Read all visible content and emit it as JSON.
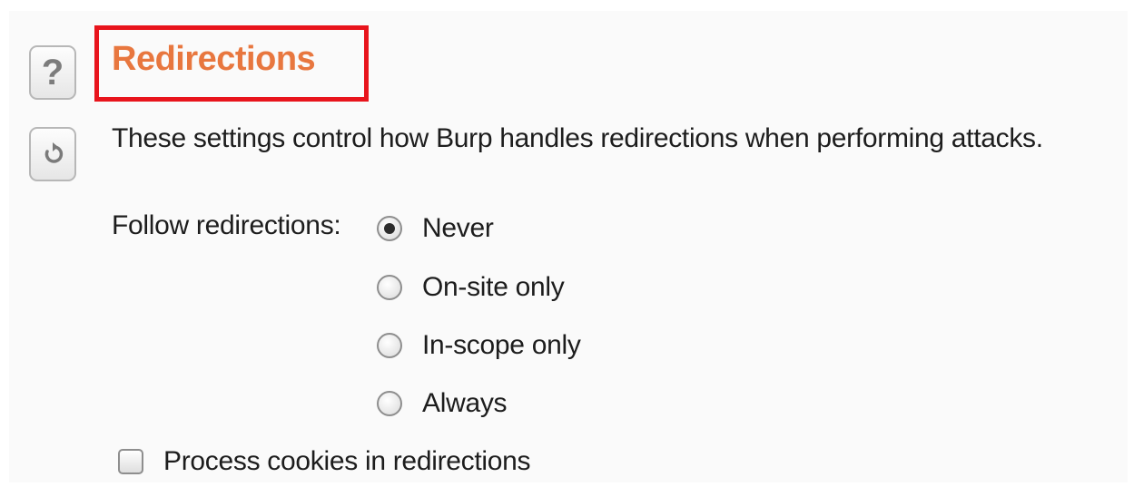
{
  "section": {
    "title": "Redirections",
    "description": "These settings control how Burp handles redirections when performing attacks."
  },
  "buttons": {
    "help_label": "?",
    "help_icon": "help-icon",
    "restore_icon": "restore-defaults-icon"
  },
  "follow": {
    "label": "Follow redirections:",
    "selected": "Never",
    "options": [
      {
        "label": "Never",
        "checked": true
      },
      {
        "label": "On-site only",
        "checked": false
      },
      {
        "label": "In-scope only",
        "checked": false
      },
      {
        "label": "Always",
        "checked": false
      }
    ]
  },
  "cookies": {
    "label": "Process cookies in redirections",
    "checked": false
  },
  "colors": {
    "title": "#e8773f",
    "highlight": "#e8141c",
    "text": "#1d1d1d"
  }
}
